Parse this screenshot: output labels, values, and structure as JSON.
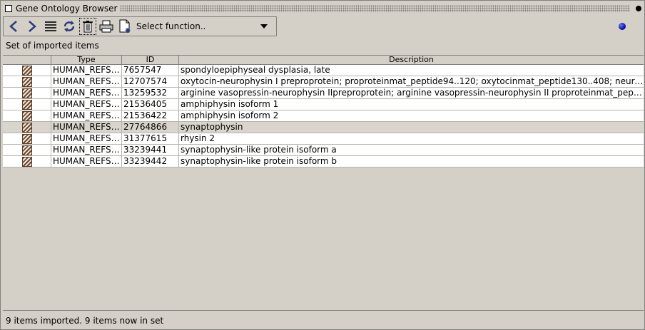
{
  "window": {
    "title": "Gene Ontology Browser"
  },
  "toolbar": {
    "buttons": [
      {
        "icon": "back-arrow-icon"
      },
      {
        "icon": "forward-arrow-icon"
      },
      {
        "icon": "list-icon"
      },
      {
        "icon": "refresh-icon"
      },
      {
        "icon": "trash-icon"
      },
      {
        "icon": "print-icon"
      },
      {
        "icon": "new-document-icon"
      }
    ],
    "select_function": "Select function.."
  },
  "set_label": "Set of imported items",
  "table": {
    "columns": [
      "",
      "Type",
      "ID",
      "Description"
    ],
    "rows": [
      {
        "type": "HUMAN_REFSEQ",
        "id": "7657547",
        "description": "spondyloepiphyseal dysplasia, late"
      },
      {
        "type": "HUMAN_REFSEQ",
        "id": "12707574",
        "description": "oxytocin-neurophysin I preproprotein; proproteinmat_peptide94..120; oxytocinmat_peptide130..408; neuro..."
      },
      {
        "type": "HUMAN_REFSEQ",
        "id": "13259532",
        "description": "arginine vasopressin-neurophysin IIpreproprotein; arginine vasopressin-neurophysin II proproteinmat_peptid..."
      },
      {
        "type": "HUMAN_REFSEQ",
        "id": "21536405",
        "description": "amphiphysin isoform 1"
      },
      {
        "type": "HUMAN_REFSEQ",
        "id": "21536422",
        "description": "amphiphysin isoform 2"
      },
      {
        "type": "HUMAN_REFSEQ",
        "id": "27764866",
        "description": "synaptophysin"
      },
      {
        "type": "HUMAN_REFSEQ",
        "id": "31377615",
        "description": "rhysin 2"
      },
      {
        "type": "HUMAN_REFSEQ",
        "id": "33239441",
        "description": "synaptophysin-like protein isoform a"
      },
      {
        "type": "HUMAN_REFSEQ",
        "id": "33239442",
        "description": "synaptophysin-like protein isoform b"
      }
    ],
    "selected_row_index": 5
  },
  "status": "9 items imported. 9 items now in set",
  "colors": {
    "selected_row": "#d9d5cd",
    "panel": "#d4d0c8",
    "orb": "#1010a0"
  }
}
